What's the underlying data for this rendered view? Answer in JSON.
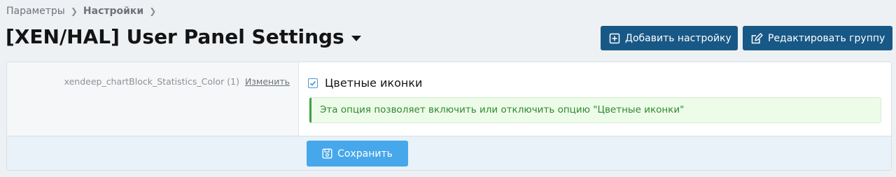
{
  "breadcrumb": {
    "items": [
      "Параметры",
      "Настройки"
    ]
  },
  "page": {
    "title": "[XEN/HAL] User Panel Settings"
  },
  "actions": {
    "add_label": "Добавить настройку",
    "edit_label": "Редактировать группу"
  },
  "option": {
    "id_label": "xendeep_chartBlock_Statistics_Color (1)",
    "edit_link": "Изменить",
    "checkbox_label": "Цветные иконки",
    "checked": true,
    "hint": "Эта опция позволяет включить или отключить опцию \"Цветные иконки\""
  },
  "footer": {
    "save_label": "Сохранить"
  },
  "colors": {
    "primary_button": "#185886",
    "save_button": "#47a7eb",
    "hint_text": "#2e8a2e"
  }
}
